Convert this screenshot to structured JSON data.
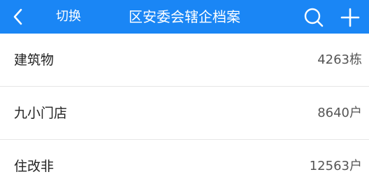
{
  "header": {
    "switch_label": "切换",
    "title": "区安委会辖企档案",
    "background_color": "#1a86f5"
  },
  "icons": {
    "back": "chevron-left-icon",
    "search": "search-icon",
    "add": "plus-icon"
  },
  "list": {
    "items": [
      {
        "label": "建筑物",
        "value": "4263栋"
      },
      {
        "label": "九小门店",
        "value": "8640户"
      },
      {
        "label": "住改非",
        "value": "12563户"
      }
    ]
  }
}
